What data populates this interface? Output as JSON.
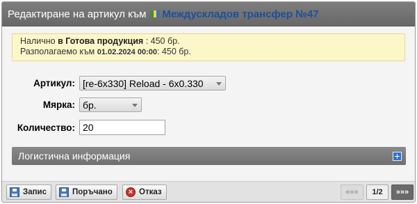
{
  "title": {
    "prefix": "Редактиране на артикул към",
    "doc_link": "Междускладов трансфер №47"
  },
  "info": {
    "line1_prefix": "Налично",
    "line1_bold": "в Готова продукция",
    "line1_suffix": ": 450 бр.",
    "line2_prefix": "Разполагаемо към",
    "line2_date": "01.02.2024 00:00",
    "line2_suffix": ": 450 бр."
  },
  "form": {
    "article_label": "Артикул:",
    "article_value": "[re-6x330] Reload - 6x0.330",
    "unit_label": "Мярка:",
    "unit_value": "бр.",
    "qty_label": "Количество:",
    "qty_value": "20"
  },
  "section": {
    "logistics_label": "Логистична информация"
  },
  "toolbar": {
    "save_label": "Запис",
    "ordered_label": "Поръчано",
    "cancel_label": "Отказ",
    "prev_label": "«««",
    "page_label": "1/2",
    "next_label": "»»»"
  },
  "colors": {
    "titlebar": "#707070",
    "doc_link": "#1d4f9c",
    "info_bg": "#fbf7c9",
    "section_bar": "#7a7a7a"
  },
  "icons": [
    "document-icon",
    "plus-icon",
    "save-icon",
    "ordered-icon",
    "cancel-icon"
  ]
}
